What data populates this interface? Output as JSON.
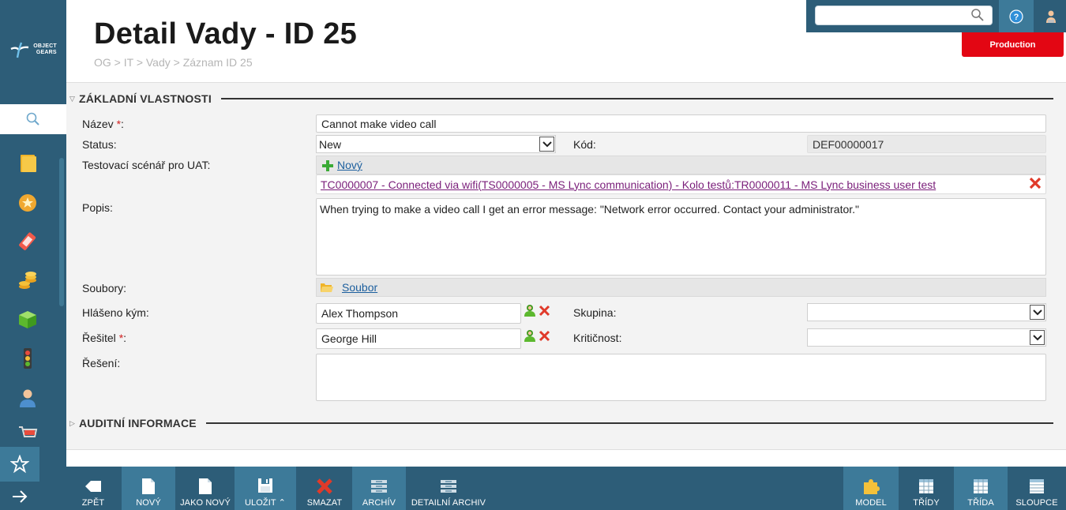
{
  "logo": {
    "line1": "OBJECT",
    "line2": "GEARS"
  },
  "header": {
    "title": "Detail Vady - ID 25",
    "breadcrumb": "OG > IT > Vady > Záznam ID 25",
    "search_value": "",
    "environment": "Production"
  },
  "sections": {
    "basic": "ZÁKLADNÍ VLASTNOSTI",
    "audit": "AUDITNÍ INFORMACE"
  },
  "form": {
    "name_label": "Název",
    "name_value": "Cannot make video call",
    "status_label": "Status:",
    "status_value": "New",
    "code_label": "Kód:",
    "code_value": "DEF00000017",
    "scenario_label": "Testovací scénář pro UAT:",
    "scenario_new": "Nový",
    "scenario_link": "TC0000007 - Connected via wifi(TS0000005 - MS Lync communication) - Kolo testů:TR0000011 - MS Lync business user test",
    "description_label": "Popis:",
    "description_value": "When trying to make a video call I get an error message: \"Network error occurred. Contact your administrator.\"",
    "files_label": "Soubory:",
    "files_link": "Soubor",
    "reported_label": "Hlášeno kým:",
    "reported_value": "Alex Thompson",
    "group_label": "Skupina:",
    "group_value": "",
    "solver_label": "Řešitel",
    "solver_value": "George Hill",
    "criticality_label": "Kritičnost:",
    "criticality_value": "",
    "solution_label": "Řešení:",
    "solution_value": "",
    "required_mark": "*",
    "colon": ":"
  },
  "toolbar": {
    "back": "ZPĚT",
    "new": "NOVÝ",
    "as_new": "JAKO NOVÝ",
    "save": "ULOŽIT",
    "delete": "SMAZAT",
    "archive": "ARCHÍV",
    "detail_archive": "DETAILNÍ ARCHIV",
    "model": "MODEL",
    "classes": "TŘÍDY",
    "class": "TŘÍDA",
    "columns": "SLOUPCE"
  },
  "colors": {
    "primary": "#2d5d78",
    "secondary": "#3d7a99",
    "danger": "#e30613"
  }
}
